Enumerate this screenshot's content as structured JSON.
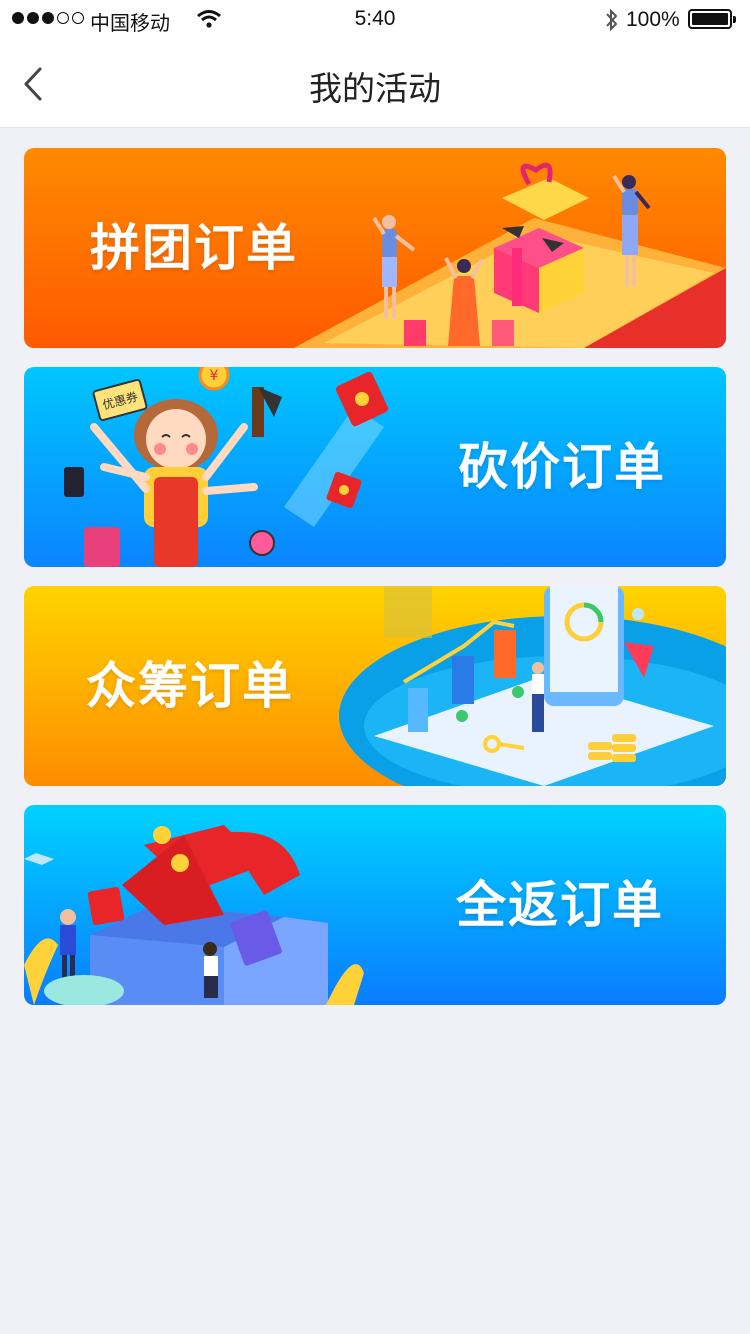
{
  "status_bar": {
    "carrier": "中国移动",
    "time": "5:40",
    "battery": "100%"
  },
  "nav": {
    "title": "我的活动",
    "back_icon": "chevron-left-icon"
  },
  "banners": [
    {
      "label": "拼团订单",
      "colors": [
        "#ff8a00",
        "#ff5a00"
      ]
    },
    {
      "label": "砍价订单",
      "colors": [
        "#00c6ff",
        "#0a84ff"
      ]
    },
    {
      "label": "众筹订单",
      "colors": [
        "#ffd400",
        "#ff8c00"
      ]
    },
    {
      "label": "全返订单",
      "colors": [
        "#00d2ff",
        "#0a7cff"
      ]
    }
  ],
  "illustrations": {
    "coupon_text": "优惠券",
    "currency_symbol": "¥"
  }
}
